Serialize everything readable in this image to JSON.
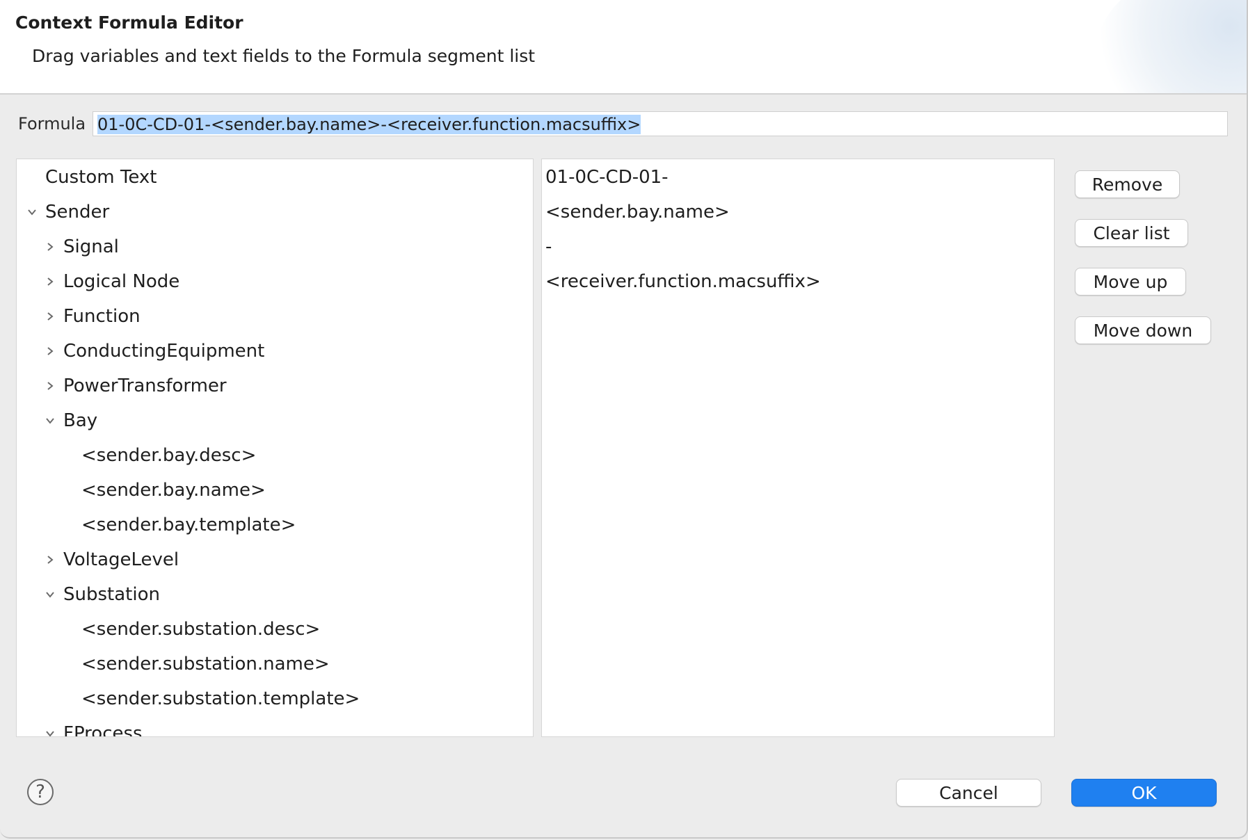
{
  "banner": {
    "title": "Context Formula Editor",
    "description": "Drag variables and text fields to the Formula segment list"
  },
  "formula": {
    "label": "Formula",
    "value": "01-0C-CD-01-<sender.bay.name>-<receiver.function.macsuffix>"
  },
  "tree": {
    "items": [
      {
        "label": "Custom Text",
        "depth": 0,
        "expandable": false
      },
      {
        "label": "Sender",
        "depth": 0,
        "expandable": true,
        "expanded": true
      },
      {
        "label": "Signal",
        "depth": 1,
        "expandable": true,
        "expanded": false
      },
      {
        "label": "Logical Node",
        "depth": 1,
        "expandable": true,
        "expanded": false
      },
      {
        "label": "Function",
        "depth": 1,
        "expandable": true,
        "expanded": false
      },
      {
        "label": "ConductingEquipment",
        "depth": 1,
        "expandable": true,
        "expanded": false
      },
      {
        "label": "PowerTransformer",
        "depth": 1,
        "expandable": true,
        "expanded": false
      },
      {
        "label": "Bay",
        "depth": 1,
        "expandable": true,
        "expanded": true
      },
      {
        "label": "<sender.bay.desc>",
        "depth": 2,
        "expandable": false
      },
      {
        "label": "<sender.bay.name>",
        "depth": 2,
        "expandable": false
      },
      {
        "label": "<sender.bay.template>",
        "depth": 2,
        "expandable": false
      },
      {
        "label": "VoltageLevel",
        "depth": 1,
        "expandable": true,
        "expanded": false
      },
      {
        "label": "Substation",
        "depth": 1,
        "expandable": true,
        "expanded": true
      },
      {
        "label": "<sender.substation.desc>",
        "depth": 2,
        "expandable": false
      },
      {
        "label": "<sender.substation.name>",
        "depth": 2,
        "expandable": false
      },
      {
        "label": "<sender.substation.template>",
        "depth": 2,
        "expandable": false
      },
      {
        "label": "FProcess",
        "depth": 1,
        "expandable": true,
        "expanded": true
      }
    ]
  },
  "segments": {
    "items": [
      "01-0C-CD-01-",
      "<sender.bay.name>",
      "-",
      "<receiver.function.macsuffix>"
    ]
  },
  "side_buttons": {
    "remove": "Remove",
    "clear_list": "Clear list",
    "move_up": "Move up",
    "move_down": "Move down"
  },
  "footer": {
    "help_glyph": "?",
    "cancel": "Cancel",
    "ok": "OK"
  },
  "colors": {
    "primary": "#1f80f0",
    "selection": "#b3d7ff",
    "background": "#ececec"
  }
}
